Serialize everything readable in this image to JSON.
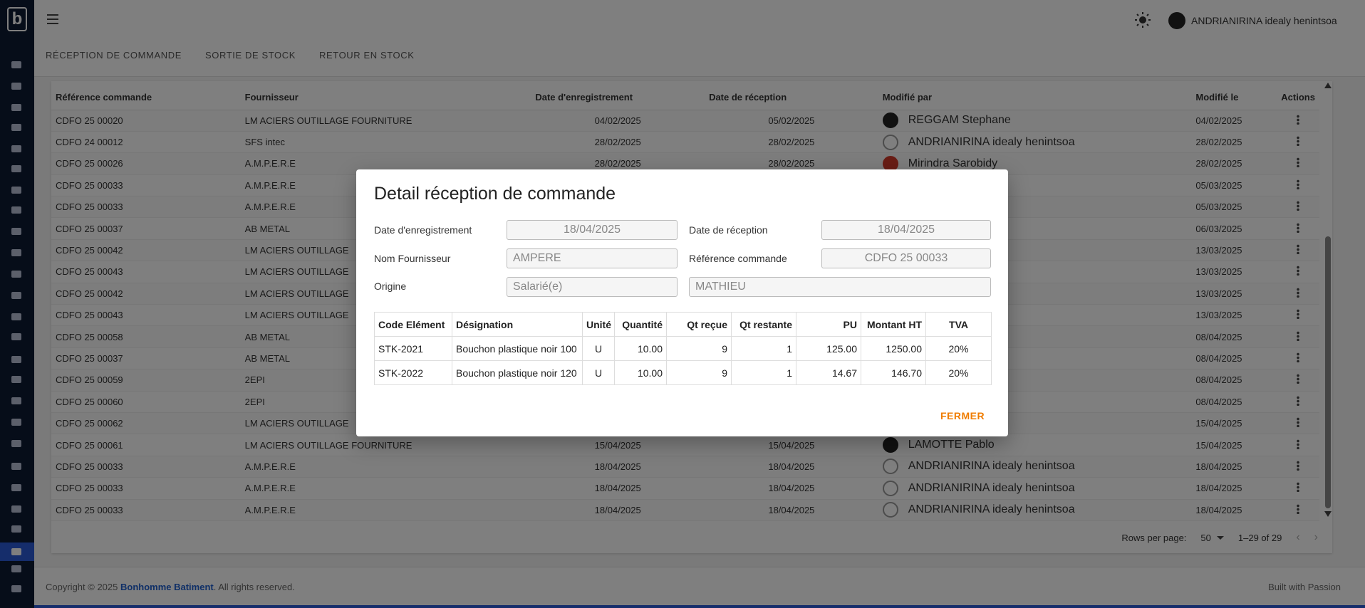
{
  "header": {
    "logo_letter": "b",
    "user_name": "ANDRIANIRINA idealy henintsoa",
    "tabs": [
      "RÉCEPTION DE COMMANDE",
      "SORTIE DE STOCK",
      "RETOUR EN STOCK"
    ]
  },
  "table": {
    "columns": [
      "Référence commande",
      "Fournisseur",
      "Date d'enregistrement",
      "Date de réception",
      "Modifié par",
      "Modifié le",
      "Actions"
    ],
    "rows": [
      {
        "ref": "CDFO 25 00020",
        "fournisseur": "LM ACIERS OUTILLAGE FOURNITURE",
        "date_enr": "04/02/2025",
        "date_rec": "05/02/2025",
        "modifie_par": "REGGAM Stephane",
        "modifie_le": "04/02/2025"
      },
      {
        "ref": "CDFO 24 00012",
        "fournisseur": "SFS intec",
        "date_enr": "28/02/2025",
        "date_rec": "28/02/2025",
        "modifie_par": "ANDRIANIRINA idealy henintsoa",
        "modifie_le": "28/02/2025"
      },
      {
        "ref": "CDFO 25 00026",
        "fournisseur": "A.M.P.E.R.E",
        "date_enr": "28/02/2025",
        "date_rec": "28/02/2025",
        "modifie_par": "Mirindra Sarobidy",
        "modifie_le": "28/02/2025"
      },
      {
        "ref": "CDFO 25 00033",
        "fournisseur": "A.M.P.E.R.E",
        "date_enr": "",
        "date_rec": "",
        "modifie_par": "",
        "modifie_le": "05/03/2025"
      },
      {
        "ref": "CDFO 25 00033",
        "fournisseur": "A.M.P.E.R.E",
        "date_enr": "",
        "date_rec": "",
        "modifie_par": "",
        "modifie_le": "05/03/2025"
      },
      {
        "ref": "CDFO 25 00037",
        "fournisseur": "AB METAL",
        "date_enr": "",
        "date_rec": "",
        "modifie_par": "",
        "modifie_le": "06/03/2025"
      },
      {
        "ref": "CDFO 25 00042",
        "fournisseur": "LM ACIERS OUTILLAGE",
        "date_enr": "",
        "date_rec": "",
        "modifie_par": "",
        "modifie_le": "13/03/2025"
      },
      {
        "ref": "CDFO 25 00043",
        "fournisseur": "LM ACIERS OUTILLAGE",
        "date_enr": "",
        "date_rec": "",
        "modifie_par": "",
        "modifie_le": "13/03/2025"
      },
      {
        "ref": "CDFO 25 00042",
        "fournisseur": "LM ACIERS OUTILLAGE",
        "date_enr": "",
        "date_rec": "",
        "modifie_par": "",
        "modifie_le": "13/03/2025"
      },
      {
        "ref": "CDFO 25 00043",
        "fournisseur": "LM ACIERS OUTILLAGE",
        "date_enr": "",
        "date_rec": "",
        "modifie_par": "",
        "modifie_le": "13/03/2025"
      },
      {
        "ref": "CDFO 25 00058",
        "fournisseur": "AB METAL",
        "date_enr": "",
        "date_rec": "",
        "modifie_par": "intsoa",
        "modifie_le": "08/04/2025"
      },
      {
        "ref": "CDFO 25 00037",
        "fournisseur": "AB METAL",
        "date_enr": "",
        "date_rec": "",
        "modifie_par": "intsoa",
        "modifie_le": "08/04/2025"
      },
      {
        "ref": "CDFO 25 00059",
        "fournisseur": "2EPI",
        "date_enr": "",
        "date_rec": "",
        "modifie_par": "intsoa",
        "modifie_le": "08/04/2025"
      },
      {
        "ref": "CDFO 25 00060",
        "fournisseur": "2EPI",
        "date_enr": "",
        "date_rec": "",
        "modifie_par": "intsoa",
        "modifie_le": "08/04/2025"
      },
      {
        "ref": "CDFO 25 00062",
        "fournisseur": "LM ACIERS OUTILLAGE",
        "date_enr": "",
        "date_rec": "",
        "modifie_par": "",
        "modifie_le": "15/04/2025"
      },
      {
        "ref": "CDFO 25 00061",
        "fournisseur": "LM ACIERS OUTILLAGE FOURNITURE",
        "date_enr": "15/04/2025",
        "date_rec": "15/04/2025",
        "modifie_par": "LAMOTTE Pablo",
        "modifie_le": "15/04/2025"
      },
      {
        "ref": "CDFO 25 00033",
        "fournisseur": "A.M.P.E.R.E",
        "date_enr": "18/04/2025",
        "date_rec": "18/04/2025",
        "modifie_par": "ANDRIANIRINA idealy henintsoa",
        "modifie_le": "18/04/2025"
      },
      {
        "ref": "CDFO 25 00033",
        "fournisseur": "A.M.P.E.R.E",
        "date_enr": "18/04/2025",
        "date_rec": "18/04/2025",
        "modifie_par": "ANDRIANIRINA idealy henintsoa",
        "modifie_le": "18/04/2025"
      },
      {
        "ref": "CDFO 25 00033",
        "fournisseur": "A.M.P.E.R.E",
        "date_enr": "18/04/2025",
        "date_rec": "18/04/2025",
        "modifie_par": "ANDRIANIRINA idealy henintsoa",
        "modifie_le": "18/04/2025"
      }
    ],
    "avatars": [
      "dark",
      "outline",
      "red",
      "",
      "",
      "",
      "",
      "",
      "",
      "",
      "",
      "",
      "",
      "",
      "",
      "dark",
      "outline",
      "outline",
      "outline"
    ]
  },
  "pagination": {
    "rows_per_page_label": "Rows per page:",
    "rows_per_page": "50",
    "range": "1–29 of 29"
  },
  "footer": {
    "copyright": "Copyright © 2025 ",
    "brand": "Bonhomme Batiment",
    "rights": ". All rights reserved.",
    "built": "Built with Passion"
  },
  "dialog": {
    "title": "Detail réception de commande",
    "labels": {
      "date_enregistrement": "Date d'enregistrement",
      "date_reception": "Date de réception",
      "nom_fournisseur": "Nom Fournisseur",
      "reference_commande": "Référence commande",
      "origine": "Origine"
    },
    "values": {
      "date_enregistrement": "18/04/2025",
      "date_reception": "18/04/2025",
      "nom_fournisseur": "AMPERE",
      "reference_commande": "CDFO 25 00033",
      "origine": "Salarié(e)",
      "origine_nom": "MATHIEU"
    },
    "table": {
      "columns": [
        "Code Elément",
        "Désignation",
        "Unité",
        "Quantité",
        "Qt reçue",
        "Qt restante",
        "PU",
        "Montant HT",
        "TVA"
      ],
      "rows": [
        [
          "STK-2021",
          "Bouchon plastique noir 100",
          "U",
          "10.00",
          "9",
          "1",
          "125.00",
          "1250.00",
          "20%"
        ],
        [
          "STK-2022",
          "Bouchon plastique noir 120",
          "U",
          "10.00",
          "9",
          "1",
          "14.67",
          "146.70",
          "20%"
        ]
      ]
    },
    "close_label": "FERMER"
  },
  "colors": {
    "sidebar": "#0d1a33",
    "accent": "#2a5bd7",
    "close_button": "#f07d00"
  }
}
